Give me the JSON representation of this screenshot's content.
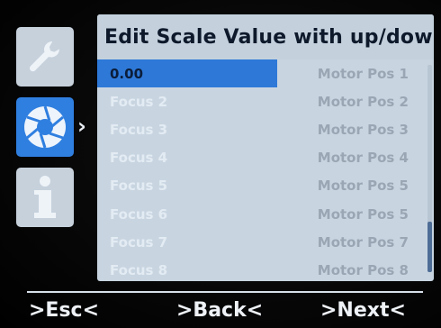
{
  "panel": {
    "title": "Edit Scale Value with up/down",
    "rows": [
      {
        "focus": "0.00",
        "motor": "Motor Pos 1",
        "selected": true
      },
      {
        "focus": "Focus 2",
        "motor": "Motor Pos 2"
      },
      {
        "focus": "Focus 3",
        "motor": "Motor Pos 3"
      },
      {
        "focus": "Focus 4",
        "motor": "Motor Pos 4"
      },
      {
        "focus": "Focus 5",
        "motor": "Motor Pos 5"
      },
      {
        "focus": "Focus 6",
        "motor": "Motor Pos 5"
      },
      {
        "focus": "Focus 7",
        "motor": "Motor Pos 7"
      },
      {
        "focus": "Focus 8",
        "motor": "Motor Pos 8"
      }
    ]
  },
  "sidebar": {
    "icons": [
      "wrench-icon",
      "aperture-icon",
      "info-icon"
    ],
    "active": "aperture-icon",
    "selector_arrow": "›"
  },
  "footer": {
    "esc_label": ">Esc<",
    "back_label": ">Back<",
    "next_label": ">Next<"
  },
  "colors": {
    "accent": "#2f7fe0",
    "panel": "#c8d5e1",
    "background": "#030303"
  }
}
